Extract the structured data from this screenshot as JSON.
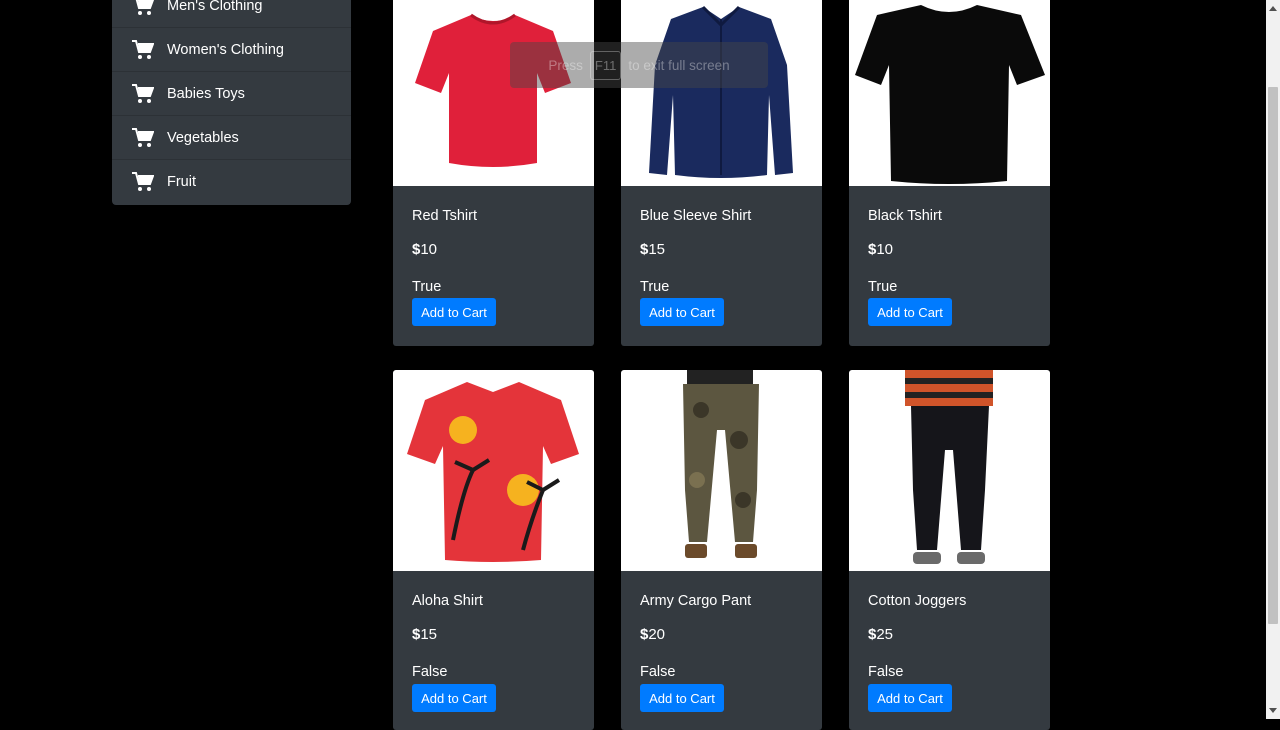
{
  "sidebar": {
    "items": [
      {
        "label": "Men's Clothing",
        "icon": "cart-icon"
      },
      {
        "label": "Women's Clothing",
        "icon": "cart-icon"
      },
      {
        "label": "Babies Toys",
        "icon": "cart-icon"
      },
      {
        "label": "Vegetables",
        "icon": "cart-icon"
      },
      {
        "label": "Fruit",
        "icon": "cart-icon"
      }
    ]
  },
  "products": [
    {
      "name": "Red Tshirt",
      "currency": "$",
      "price": "10",
      "stock": "True",
      "button": "Add to Cart",
      "image": "red-tshirt"
    },
    {
      "name": "Blue Sleeve Shirt",
      "currency": "$",
      "price": "15",
      "stock": "True",
      "button": "Add to Cart",
      "image": "blue-shirt"
    },
    {
      "name": "Black Tshirt",
      "currency": "$",
      "price": "10",
      "stock": "True",
      "button": "Add to Cart",
      "image": "black-tshirt"
    },
    {
      "name": "Aloha Shirt",
      "currency": "$",
      "price": "15",
      "stock": "False",
      "button": "Add to Cart",
      "image": "aloha-shirt"
    },
    {
      "name": "Army Cargo Pant",
      "currency": "$",
      "price": "20",
      "stock": "False",
      "button": "Add to Cart",
      "image": "cargo-pant"
    },
    {
      "name": "Cotton Joggers",
      "currency": "$",
      "price": "25",
      "stock": "False",
      "button": "Add to Cart",
      "image": "joggers"
    }
  ],
  "toast": {
    "prefix": "Press",
    "key": "F11",
    "suffix": "to exit full screen"
  },
  "colors": {
    "background": "#000000",
    "panel": "#343a40",
    "button": "#007bff"
  }
}
